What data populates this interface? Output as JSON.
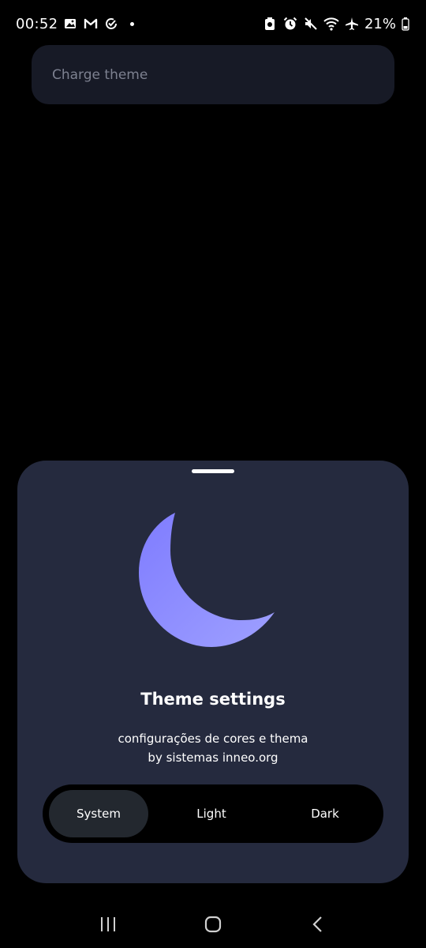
{
  "status_bar": {
    "time": "00:52",
    "battery": "21%",
    "left_icons": [
      "gallery-icon",
      "gmail-icon",
      "check-circle-icon",
      "notification-dot"
    ],
    "right_icons": [
      "battery-saver-icon",
      "alarm-icon",
      "mute-icon",
      "wifi-icon",
      "airplane-icon",
      "battery-icon"
    ]
  },
  "top_pill": {
    "text": "Charge theme"
  },
  "sheet": {
    "title": "Theme settings",
    "subtitle_line1": "configurações de cores e thema",
    "subtitle_line2": "by sistemas inneo.org",
    "icon": "moon-icon",
    "moon_color": "#8a86ff",
    "options": {
      "system": "System",
      "light": "Light",
      "dark": "Dark"
    },
    "selected": "System"
  },
  "nav_bar": {
    "icons": [
      "recents-icon",
      "home-icon",
      "back-icon"
    ]
  },
  "colors": {
    "background": "#000000",
    "sheet": "#252a3e",
    "pill": "#171a26",
    "selected_segment": "#23282f"
  }
}
